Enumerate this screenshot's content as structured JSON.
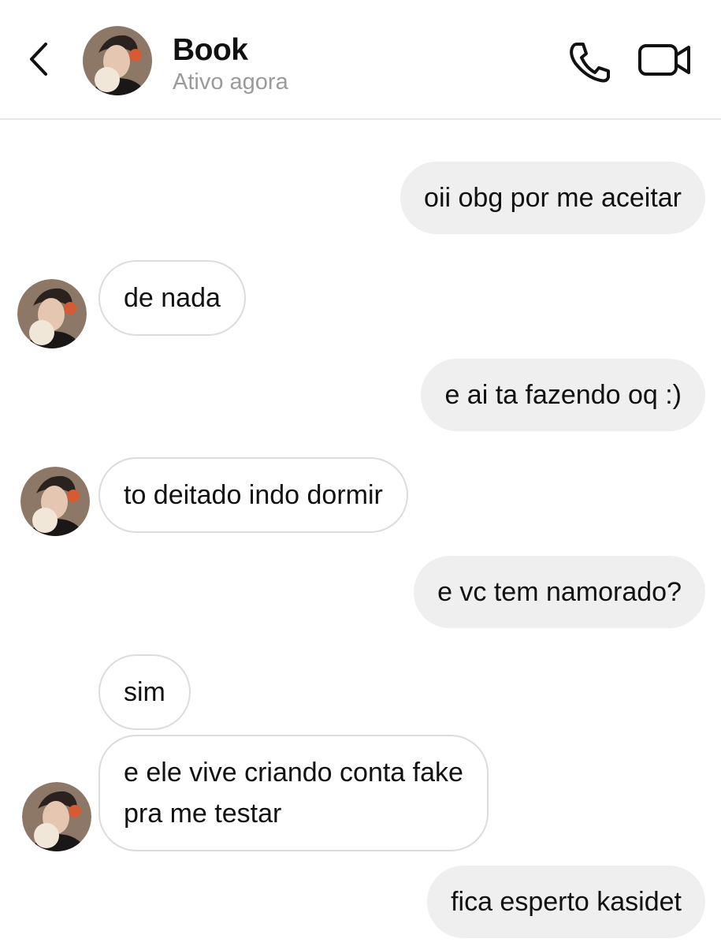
{
  "header": {
    "back_icon": "chevron-left-icon",
    "contact_name": "Book",
    "status": "Ativo agora",
    "call_icon": "phone-icon",
    "video_icon": "video-camera-icon"
  },
  "messages": [
    {
      "direction": "outgoing",
      "text": "oii obg por me aceitar"
    },
    {
      "direction": "incoming",
      "text": "de nada"
    },
    {
      "direction": "outgoing",
      "text": "e ai ta fazendo oq :)"
    },
    {
      "direction": "incoming",
      "text": "to deitado indo dormir"
    },
    {
      "direction": "outgoing",
      "text": "e vc tem namorado?"
    },
    {
      "direction": "incoming",
      "text": "sim"
    },
    {
      "direction": "incoming",
      "text_line1": "e ele vive criando conta fake",
      "text_line2": "pra me testar"
    },
    {
      "direction": "outgoing",
      "text": "fica esperto kasidet"
    }
  ],
  "colors": {
    "outgoing_bubble": "#efefef",
    "incoming_border": "#dcdcdc",
    "status_text": "#9a9a9a"
  }
}
